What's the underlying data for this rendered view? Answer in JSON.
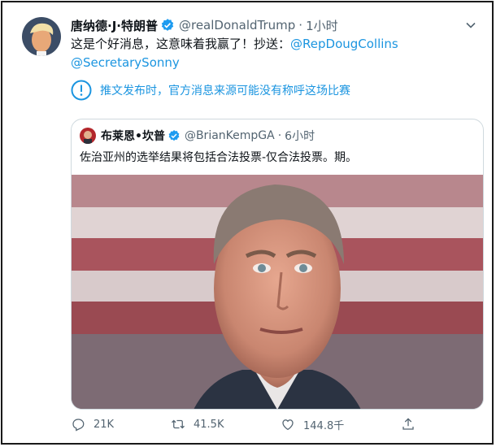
{
  "tweet": {
    "display_name": "唐纳德·J·特朗普",
    "handle": "@realDonaldTrump",
    "separator": "·",
    "time": "1小时",
    "text_before": "这是个好消息，这意味着我赢了！抄送：",
    "mention_1": "@RepDougCollins",
    "mention_2": "@SecretarySonny",
    "notice": "推文发布时，官方消息来源可能没有称呼这场比赛"
  },
  "quoted": {
    "display_name": "布莱恩•坎普",
    "handle": "@BrianKempGA",
    "separator": "·",
    "time": "6小时",
    "text": "佐治亚州的选举结果将包括合法投票-仅合法投票。期。"
  },
  "actions": {
    "reply_count": "21K",
    "retweet_count": "41.5K",
    "like_count": "144.8千"
  },
  "colors": {
    "link": "#1b95e0",
    "secondary_text": "#536471",
    "border": "#cfd9de"
  },
  "icons": [
    "verified-badge-icon",
    "chevron-down-icon",
    "info-icon",
    "reply-icon",
    "retweet-icon",
    "like-icon",
    "share-icon"
  ]
}
